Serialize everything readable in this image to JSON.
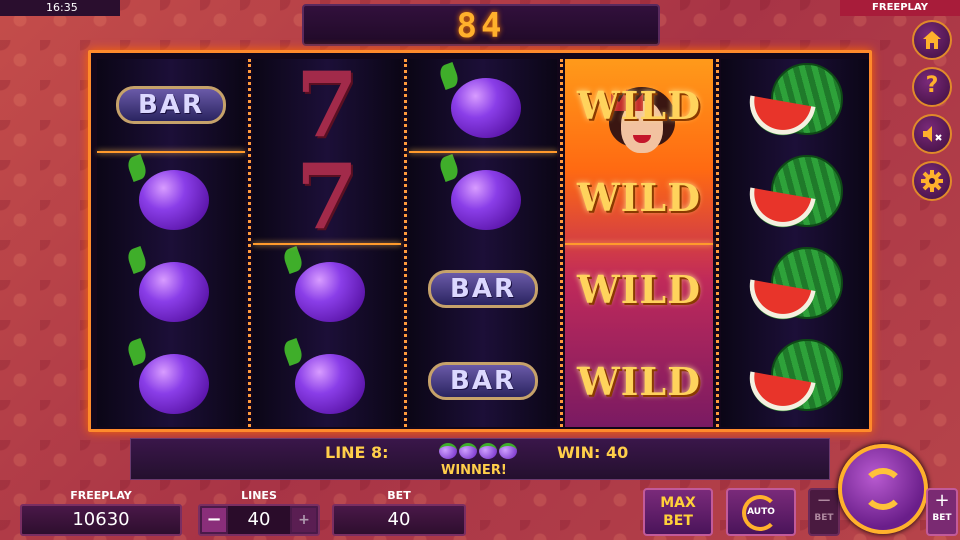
{
  "status_bar": {
    "time": "16:35",
    "mode": "FREEPLAY"
  },
  "win_display": {
    "value": "84"
  },
  "reels": [
    {
      "symbols": [
        "bar",
        "plum",
        "plum",
        "plum"
      ]
    },
    {
      "symbols": [
        "seven",
        "seven",
        "plum",
        "plum"
      ]
    },
    {
      "symbols": [
        "plum",
        "plum",
        "bar",
        "bar"
      ]
    },
    {
      "symbols": [
        "wild",
        "wild",
        "wild",
        "wild"
      ]
    },
    {
      "symbols": [
        "watermelon",
        "watermelon",
        "watermelon",
        "watermelon"
      ]
    }
  ],
  "symbol_text": {
    "bar": "BAR",
    "seven": "7",
    "wild": "WILD"
  },
  "info_bar": {
    "line_label": "LINE 8:",
    "win_label": "WIN: 40",
    "winner_label": "WINNER!"
  },
  "controls": {
    "freeplay_label": "FREEPLAY",
    "balance": "10630",
    "lines_label": "LINES",
    "lines_value": "40",
    "lines_minus": "−",
    "lines_plus": "+",
    "bet_label": "BET",
    "bet_value": "40",
    "max_bet_line1": "MAX",
    "max_bet_line2": "BET",
    "auto_label": "AUTO",
    "bet_minus_label": "BET",
    "bet_plus_label": "BET",
    "minus_glyph": "−",
    "plus_glyph": "+"
  },
  "side_menu": {
    "home_icon": "home-icon",
    "help_label": "?",
    "sound_icon": "speaker-muted-icon",
    "settings_icon": "gear-icon"
  },
  "colors": {
    "accent": "#ffb12c",
    "frame": "#ff8a2c",
    "background": "#b2424f"
  }
}
